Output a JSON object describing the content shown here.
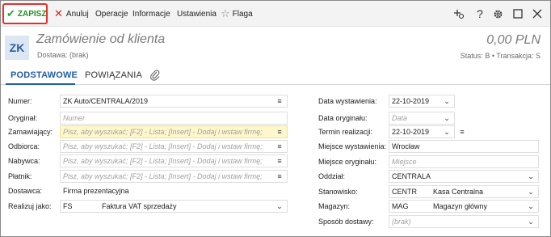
{
  "toolbar": {
    "save_label": "ZAPISZ",
    "save_icon": "✔",
    "cancel_label": "Anuluj",
    "cancel_icon": "✕",
    "operations_label": "Operacje",
    "information_label": "Informacje",
    "settings_label": "Ustawienia",
    "flag_label": "Flaga",
    "flag_icon": "☆",
    "right_icons": [
      "add-shortcut-icon",
      "help-icon",
      "gear-icon",
      "maximize-icon",
      "close-icon"
    ]
  },
  "header": {
    "badge": "ZK",
    "title": "Zamówienie od klienta",
    "subtitle": "Dostawa: (brak)",
    "amount": "0,00 PLN",
    "status": "Status: B  •  Transakcja: S"
  },
  "tabs": [
    {
      "label": "PODSTAWOWE",
      "active": true
    },
    {
      "label": "POWIĄZANIA",
      "active": false
    }
  ],
  "form_left": {
    "numer_label": "Numer:",
    "numer_value": "ZK Auto/CENTRALA/2019",
    "oryginal_label": "Oryginał:",
    "oryginal_placeholder": "Numer",
    "zamawiajacy_label": "Zamawiający:",
    "zamawiajacy_placeholder": "Pisz, aby wyszukać; [F2] - Lista; [Insert] - Dodaj i wstaw firmę;",
    "odbiorca_label": "Odbiorca:",
    "odbiorca_placeholder": "Pisz, aby wyszukać; [F2] - Lista; [Insert] - Dodaj i wstaw firmę;",
    "nabywca_label": "Nabywca:",
    "nabywca_placeholder": "Pisz, aby wyszukać; [F2] - Lista; [Insert] - Dodaj i wstaw firmę;",
    "platnik_label": "Płatnik:",
    "platnik_placeholder": "Pisz, aby wyszukać; [F2] - Lista; [Insert] - Dodaj i wstaw firmę;",
    "dostawca_label": "Dostawca:",
    "dostawca_value": "Firma prezentacyjna",
    "realizuj_label": "Realizuj jako:",
    "realizuj_code": "FS",
    "realizuj_name": "Faktura VAT sprzedaży"
  },
  "form_right": {
    "data_wyst_label": "Data wystawienia:",
    "data_wyst_value": "22-10-2019",
    "data_oryg_label": "Data oryginału:",
    "data_oryg_placeholder": "Data",
    "termin_label": "Termin realizacji:",
    "termin_value": "22-10-2019",
    "miejsce_wyst_label": "Miejsce wystawienia:",
    "miejsce_wyst_value": "Wrocław",
    "miejsce_oryg_label": "Miejsce oryginału:",
    "miejsce_oryg_placeholder": "Miejsce",
    "oddzial_label": "Oddział:",
    "oddzial_value": "CENTRALA",
    "stanowisko_label": "Stanowisko:",
    "stanowisko_code": "CENTR",
    "stanowisko_name": "Kasa Centralna",
    "magazyn_label": "Magazyn:",
    "magazyn_code": "MAG",
    "magazyn_name": "Magazyn główny",
    "sposob_label": "Sposób dostawy:",
    "sposob_placeholder": "(brak)"
  },
  "colors": {
    "accent": "#1f5ea8",
    "save_border": "#e5302b",
    "save_text": "#1e8e1e",
    "highlight_field": "#fff7cc"
  }
}
